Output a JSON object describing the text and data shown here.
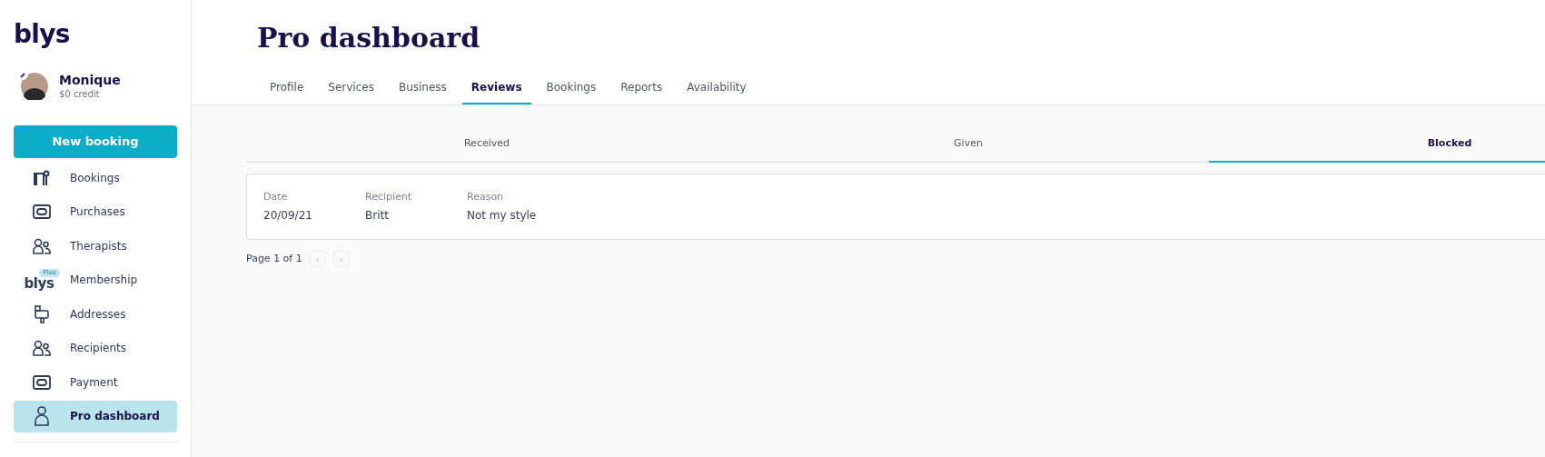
{
  "logo": "blys",
  "user": {
    "name": "Monique",
    "credit": "$0 credit"
  },
  "new_booking": "New booking",
  "nav": [
    {
      "kind": "bookings",
      "label": "Bookings",
      "selected": false
    },
    {
      "kind": "purchases",
      "label": "Purchases",
      "selected": false
    },
    {
      "kind": "people",
      "label": "Therapists",
      "selected": false
    },
    {
      "kind": "membership",
      "label": "Membership",
      "selected": false,
      "logo_text": "blys",
      "badge": "Plus"
    },
    {
      "kind": "addresses",
      "label": "Addresses",
      "selected": false
    },
    {
      "kind": "people",
      "label": "Recipients",
      "selected": false
    },
    {
      "kind": "purchases",
      "label": "Payment",
      "selected": false
    },
    {
      "kind": "person",
      "label": "Pro dashboard",
      "selected": true
    }
  ],
  "title": "Pro dashboard",
  "tabs": [
    {
      "label": "Profile",
      "selected": false
    },
    {
      "label": "Services",
      "selected": false
    },
    {
      "label": "Business",
      "selected": false
    },
    {
      "label": "Reviews",
      "selected": true
    },
    {
      "label": "Bookings",
      "selected": false
    },
    {
      "label": "Reports",
      "selected": false
    },
    {
      "label": "Availability",
      "selected": false
    }
  ],
  "subtabs": [
    {
      "label": "Received",
      "selected": false
    },
    {
      "label": "Given",
      "selected": false
    },
    {
      "label": "Blocked",
      "selected": true
    }
  ],
  "table": {
    "columns": [
      "Date",
      "Recipient",
      "Reason"
    ],
    "rows": [
      [
        "20/09/21",
        "Britt",
        "Not my style"
      ]
    ]
  },
  "pagination": {
    "text": "Page 1 of 1",
    "prev": "‹",
    "next": "›"
  }
}
